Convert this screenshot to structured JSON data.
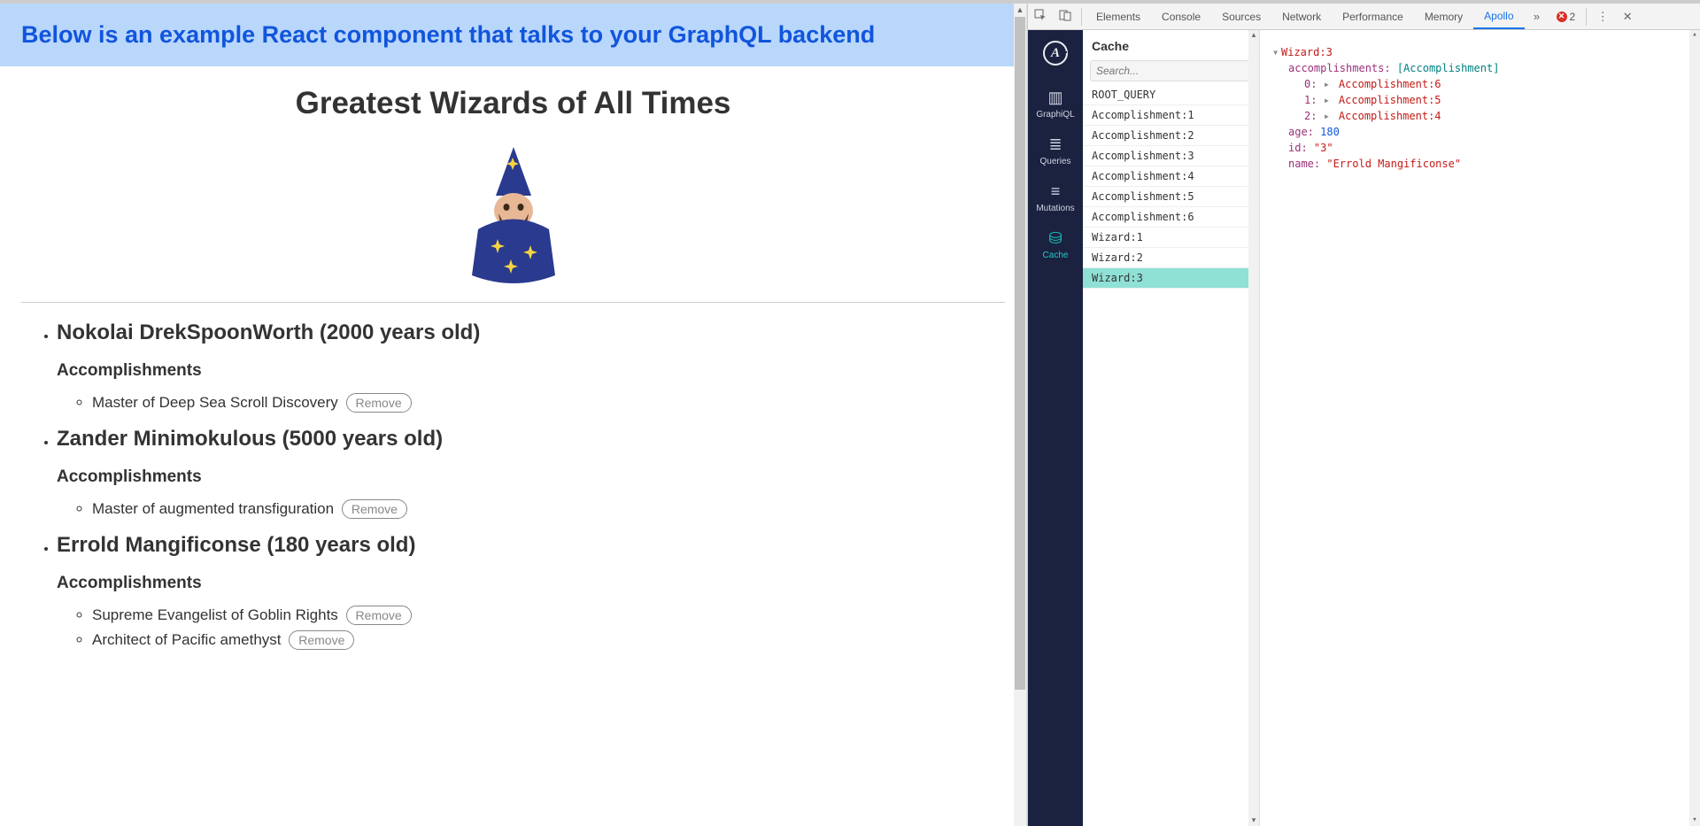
{
  "banner": "Below is an example React component that talks to your GraphQL backend",
  "page_title": "Greatest Wizards of All Times",
  "acc_header": "Accomplishments",
  "remove_label": "Remove",
  "wizards": [
    {
      "name": "Nokolai DrekSpoonWorth",
      "age": 2000,
      "accomplishments": [
        "Master of Deep Sea Scroll Discovery"
      ]
    },
    {
      "name": "Zander Minimokulous",
      "age": 5000,
      "accomplishments": [
        "Master of augmented transfiguration"
      ]
    },
    {
      "name": "Errold Mangificonse",
      "age": 180,
      "accomplishments": [
        "Supreme Evangelist of Goblin Rights",
        "Architect of Pacific amethyst"
      ]
    }
  ],
  "devtools": {
    "tabs": [
      "Elements",
      "Console",
      "Sources",
      "Network",
      "Performance",
      "Memory",
      "Apollo"
    ],
    "active_tab": "Apollo",
    "error_count": 2
  },
  "apollo": {
    "nav": [
      "GraphiQL",
      "Queries",
      "Mutations",
      "Cache"
    ],
    "active_nav": "Cache",
    "cache_header": "Cache",
    "search_placeholder": "Search...",
    "cache_items": [
      "ROOT_QUERY",
      "Accomplishment:1",
      "Accomplishment:2",
      "Accomplishment:3",
      "Accomplishment:4",
      "Accomplishment:5",
      "Accomplishment:6",
      "Wizard:1",
      "Wizard:2",
      "Wizard:3"
    ],
    "selected_cache_item": "Wizard:3",
    "detail": {
      "root_label": "Wizard:3",
      "accomplishments_key": "accomplishments",
      "accomplishments_type": "[Accomplishment]",
      "accomplishment_refs": [
        "Accomplishment:6",
        "Accomplishment:5",
        "Accomplishment:4"
      ],
      "age_key": "age",
      "age_val": 180,
      "id_key": "id",
      "id_val": "\"3\"",
      "name_key": "name",
      "name_val": "\"Errold Mangificonse\""
    }
  }
}
